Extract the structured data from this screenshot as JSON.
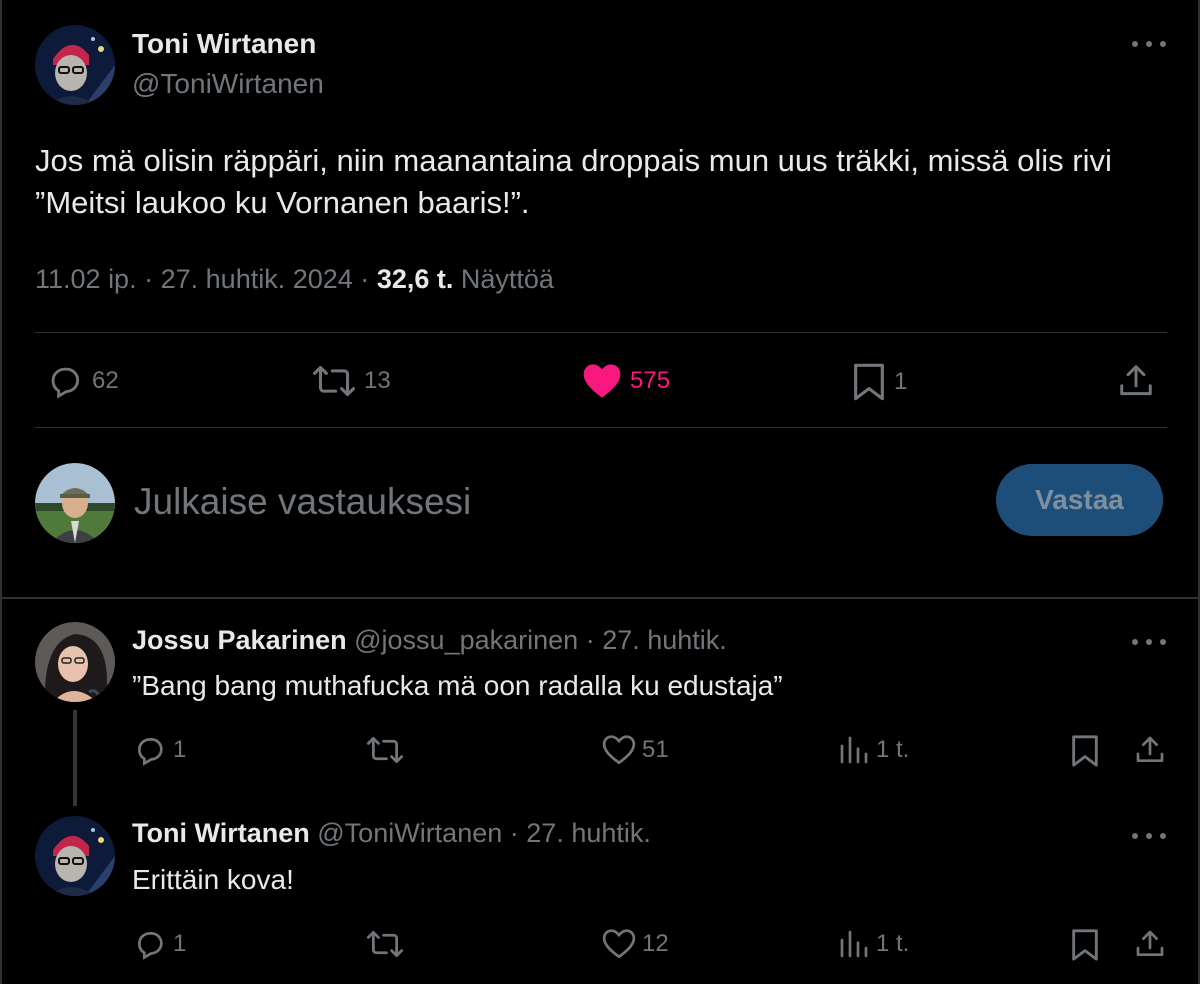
{
  "tweet": {
    "author_name": "Toni Wirtanen",
    "author_handle": "@ToniWirtanen",
    "text": "Jos mä olisin räppäri, niin maanantaina droppais mun uus träkki, missä olis rivi ”Meitsi laukoo ku Vornanen baaris!”.",
    "time": "11.02 ip.",
    "sep1": "·",
    "date": "27. huhtik. 2024",
    "sep2": "·",
    "views_count": "32,6 t.",
    "views_label": "Näyttöä",
    "stats": {
      "replies": "62",
      "retweets": "13",
      "likes": "575",
      "bookmarks": "1"
    }
  },
  "composer": {
    "placeholder": "Julkaise vastauksesi",
    "button_label": "Vastaa"
  },
  "replies": [
    {
      "name": "Jossu Pakarinen",
      "handle": "@jossu_pakarinen",
      "dot": "·",
      "date": "27. huhtik.",
      "text": "”Bang bang muthafucka mä oon radalla ku edustaja”",
      "replies": "1",
      "retweets": "",
      "likes": "51",
      "views": "1 t."
    },
    {
      "name": "Toni Wirtanen",
      "handle": "@ToniWirtanen",
      "dot": "·",
      "date": "27. huhtik.",
      "text": "Erittäin kova!",
      "replies": "1",
      "retweets": "",
      "likes": "12",
      "views": "1 t."
    }
  ],
  "colors": {
    "background": "#000000",
    "text": "#e7e9ea",
    "muted": "#71767b",
    "like": "#f91880",
    "button": "#1d4e7a",
    "divider": "#2f3336"
  },
  "icons": {
    "reply": "reply-icon",
    "retweet": "retweet-icon",
    "like": "heart-icon",
    "bookmark": "bookmark-icon",
    "share": "share-icon",
    "views": "views-icon",
    "more": "more-icon"
  }
}
